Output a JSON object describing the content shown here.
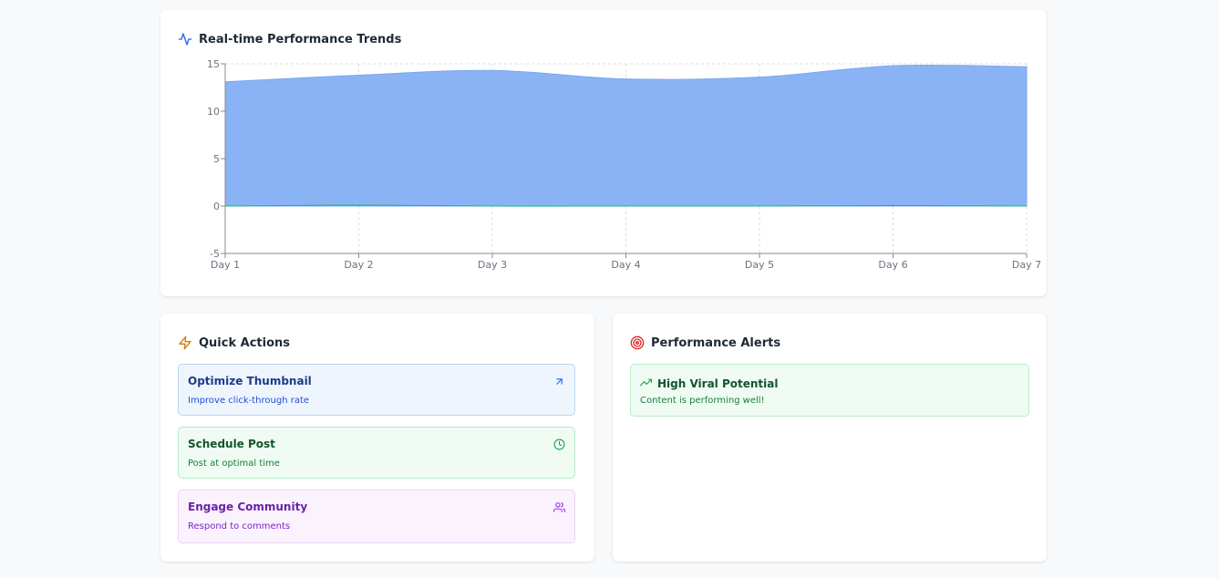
{
  "trend": {
    "title": "Real-time Performance Trends",
    "icon": "activity-icon",
    "accent": "#2563eb"
  },
  "chart_data": {
    "type": "area",
    "categories": [
      "Day 1",
      "Day 2",
      "Day 3",
      "Day 4",
      "Day 5",
      "Day 6",
      "Day 7"
    ],
    "series": [
      {
        "values": [
          13.1,
          13.8,
          14.3,
          13.4,
          13.6,
          14.8,
          14.7
        ],
        "color": "#8ab3f5"
      },
      {
        "values": [
          0.0,
          0.1,
          0.0,
          0.0,
          0.0,
          0.05,
          0.0
        ],
        "color": "#10b981"
      }
    ],
    "ylim": [
      -5,
      15
    ],
    "yticks": [
      -5,
      0,
      5,
      10,
      15
    ],
    "grid": true,
    "xlabel": "",
    "ylabel": ""
  },
  "quick_actions": {
    "title": "Quick Actions",
    "icon": "lightning-icon",
    "items": [
      {
        "title": "Optimize Thumbnail",
        "subtitle": "Improve click-through rate",
        "icon": "arrow-up-right-icon"
      },
      {
        "title": "Schedule Post",
        "subtitle": "Post at optimal time",
        "icon": "clock-icon"
      },
      {
        "title": "Engage Community",
        "subtitle": "Respond to comments",
        "icon": "users-icon"
      }
    ]
  },
  "alerts": {
    "title": "Performance Alerts",
    "icon": "target-icon",
    "items": [
      {
        "title": "High Viral Potential",
        "subtitle": "Content is performing well!",
        "icon": "trending-up-icon"
      }
    ]
  }
}
